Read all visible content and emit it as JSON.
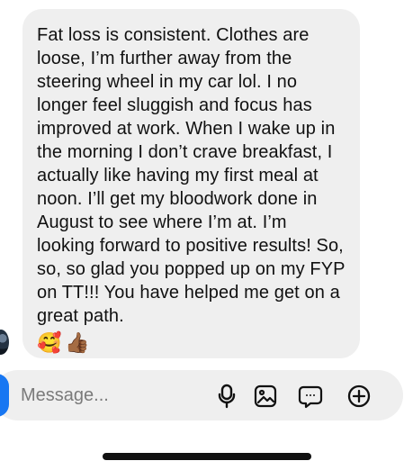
{
  "conversation": {
    "message_text": "Fat loss is consistent. Clothes are loose, I’m further away from the steering wheel in my car lol. I no longer feel sluggish and focus has improved at work. When I wake up in the morning I don’t crave breakfast, I actually like having my first meal at noon. I’ll get my bloodwork done in August to see where I’m at. I’m looking forward to positive results! So, so, so glad you popped up on my FYP on TT!!! You have helped me get on a great path.",
    "emoji_1": "🥰",
    "emoji_2": "👍🏾"
  },
  "composer": {
    "placeholder": "Message..."
  },
  "icons": {
    "avatar": "avatar",
    "camera": "camera-icon",
    "mic": "microphone-icon",
    "gallery": "image-gallery-icon",
    "sticker": "sticker-chat-icon",
    "add": "add-circle-icon"
  },
  "colors": {
    "bubble_background": "#efefef",
    "composer_background": "#efefef",
    "accent_blue": "#1877f2",
    "text_primary": "#111111",
    "placeholder_text": "#7a7a7a"
  }
}
